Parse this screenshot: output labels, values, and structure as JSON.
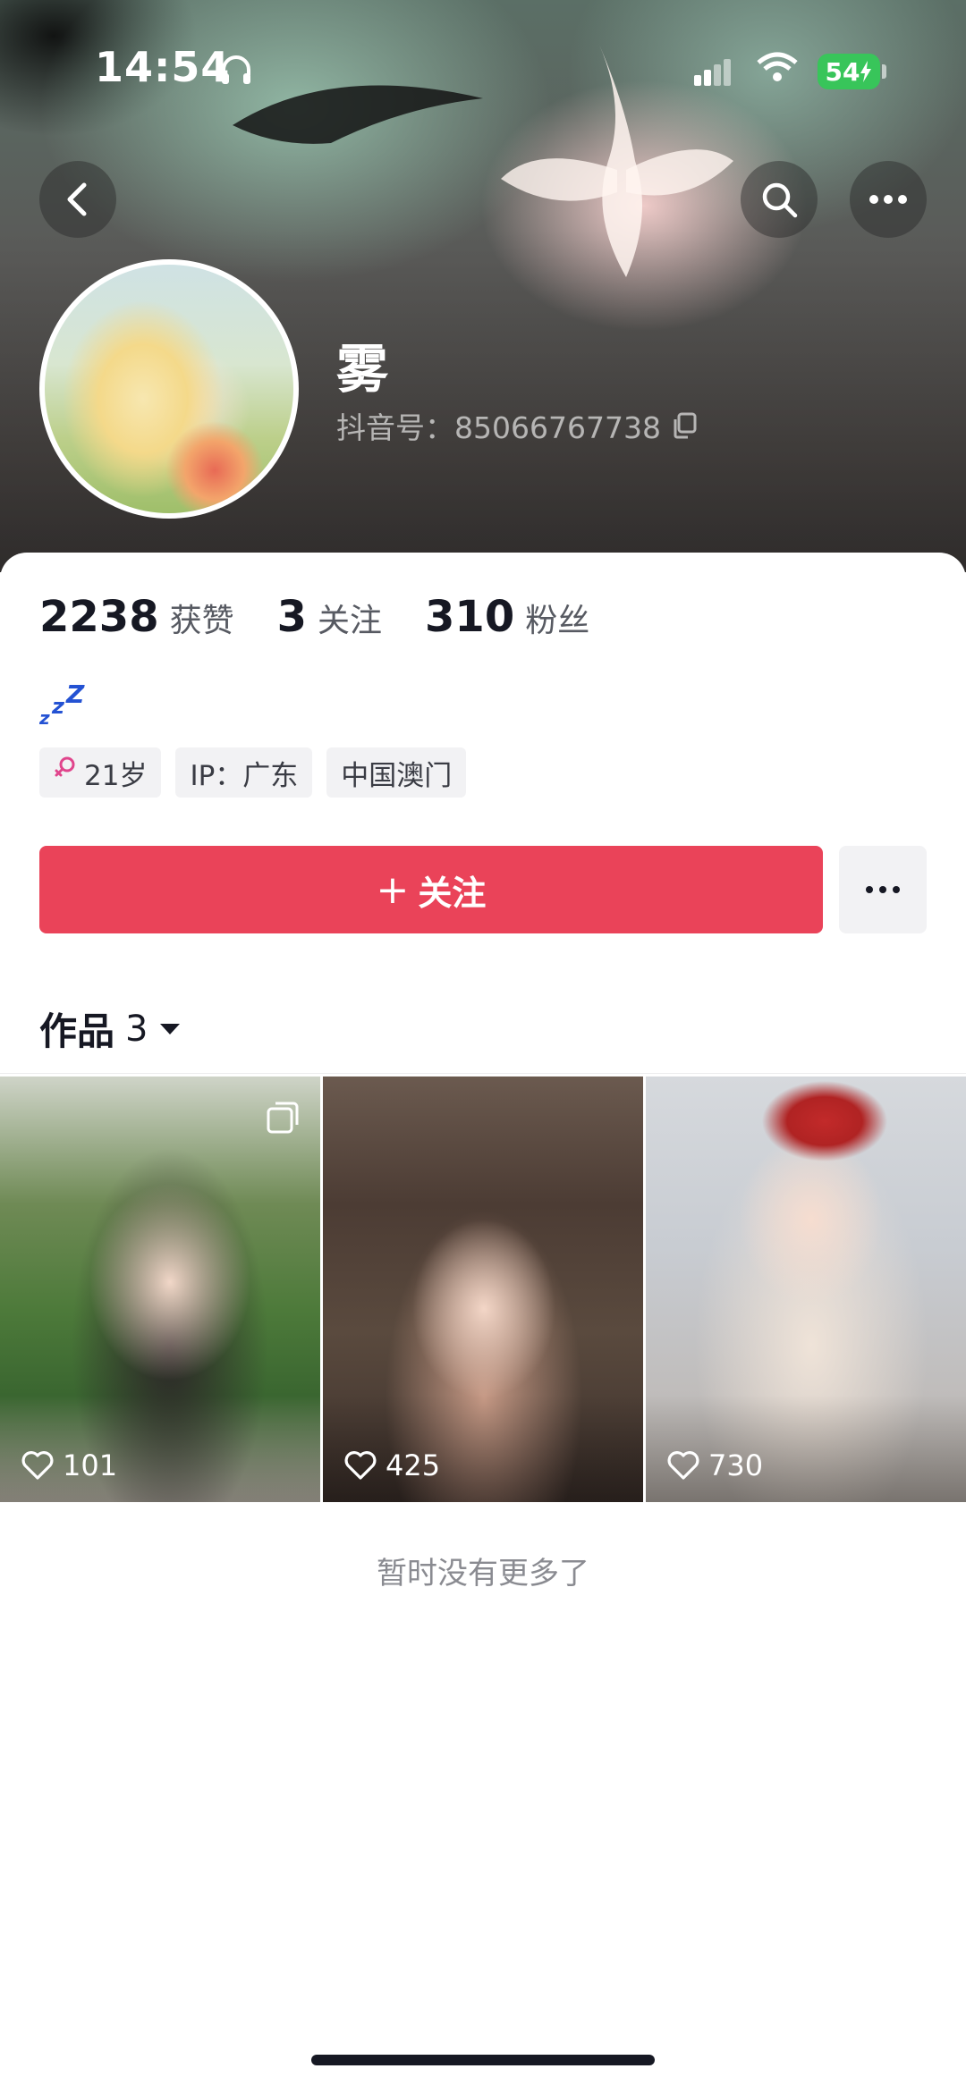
{
  "status_bar": {
    "time": "14:54",
    "battery": "54"
  },
  "profile": {
    "name": "雾",
    "douyin_id": "抖音号：85066767738",
    "stats": [
      {
        "value": "2238",
        "label": "获赞"
      },
      {
        "value": "3",
        "label": "关注"
      },
      {
        "value": "310",
        "label": "粉丝"
      }
    ],
    "signature": "zzZ",
    "tags": {
      "age": "21岁",
      "ip": "IP：广东",
      "location": "中国澳门"
    }
  },
  "actions": {
    "follow_plus": "+",
    "follow_label": "关注"
  },
  "works": {
    "tab_label": "作品",
    "count": "3",
    "items": [
      {
        "likes": "101"
      },
      {
        "likes": "425"
      },
      {
        "likes": "730"
      }
    ],
    "end_text": "暂时没有更多了"
  },
  "colors": {
    "follow_button": "#ea4359",
    "battery": "#38c55a"
  }
}
